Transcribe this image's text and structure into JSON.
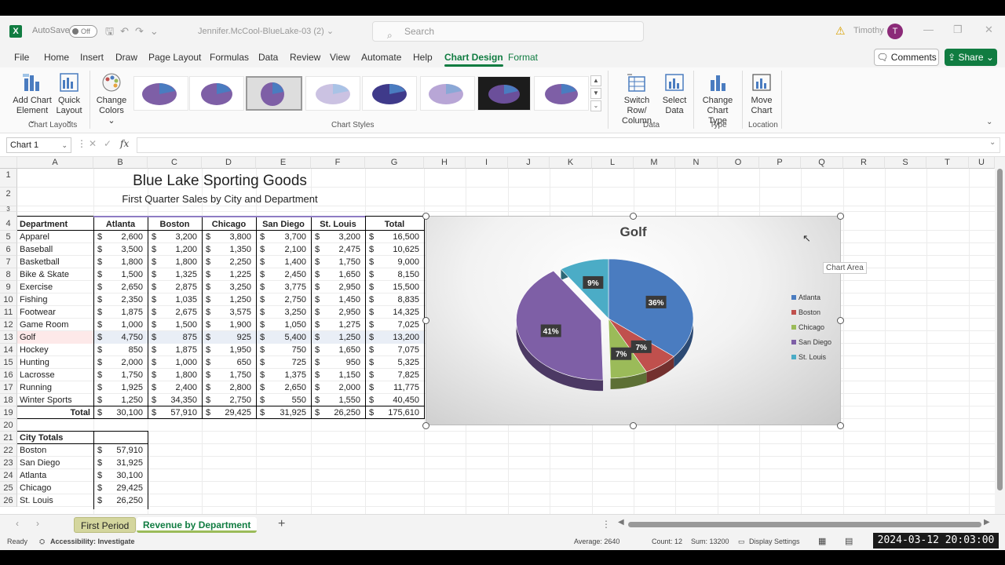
{
  "titlebar": {
    "autosave_label": "AutoSave",
    "toggle_label": "Off",
    "filename": "Jennifer.McCool-BlueLake-03 (2) ⌄",
    "search_placeholder": "Search",
    "username": "Timothy",
    "avatar_initial": "T"
  },
  "ribbon_tabs": [
    "File",
    "Home",
    "Insert",
    "Draw",
    "Page Layout",
    "Formulas",
    "Data",
    "Review",
    "View",
    "Automate",
    "Help",
    "Chart Design",
    "Format"
  ],
  "active_tab": "Chart Design",
  "buttons": {
    "comments": "Comments",
    "share": "Share"
  },
  "ribbon": {
    "add_chart_element": [
      "Add Chart",
      "Element ⌄"
    ],
    "quick_layout": [
      "Quick",
      "Layout ⌄"
    ],
    "change_colors": [
      "Change",
      "Colors ⌄"
    ],
    "switch_row_col": [
      "Switch Row/",
      "Column"
    ],
    "select_data": [
      "Select",
      "Data"
    ],
    "change_chart_type": [
      "Change",
      "Chart Type"
    ],
    "move_chart": [
      "Move",
      "Chart"
    ],
    "group_labels": {
      "chart_layouts": "Chart Layouts",
      "chart_styles": "Chart Styles",
      "data": "Data",
      "type": "Type",
      "location": "Location"
    }
  },
  "formula_bar": {
    "name_box": "Chart 1",
    "fx": "fx"
  },
  "columns": [
    "A",
    "B",
    "C",
    "D",
    "E",
    "F",
    "G",
    "H",
    "I",
    "J",
    "K",
    "L",
    "M",
    "N",
    "O",
    "P",
    "Q",
    "R",
    "S",
    "T",
    "U"
  ],
  "sheet": {
    "title": "Blue Lake Sporting Goods",
    "subtitle": "First Quarter Sales by City and Department",
    "headers": [
      "Department",
      "Atlanta",
      "Boston",
      "Chicago",
      "San Diego",
      "St. Louis",
      "Total"
    ],
    "rows": [
      [
        "Apparel",
        "2,600",
        "3,200",
        "3,800",
        "3,700",
        "3,200",
        "16,500"
      ],
      [
        "Baseball",
        "3,500",
        "1,200",
        "1,350",
        "2,100",
        "2,475",
        "10,625"
      ],
      [
        "Basketball",
        "1,800",
        "1,800",
        "2,250",
        "1,400",
        "1,750",
        "9,000"
      ],
      [
        "Bike & Skate",
        "1,500",
        "1,325",
        "1,225",
        "2,450",
        "1,650",
        "8,150"
      ],
      [
        "Exercise",
        "2,650",
        "2,875",
        "3,250",
        "3,775",
        "2,950",
        "15,500"
      ],
      [
        "Fishing",
        "2,350",
        "1,035",
        "1,250",
        "2,750",
        "1,450",
        "8,835"
      ],
      [
        "Footwear",
        "1,875",
        "2,675",
        "3,575",
        "3,250",
        "2,950",
        "14,325"
      ],
      [
        "Game Room",
        "1,000",
        "1,500",
        "1,900",
        "1,050",
        "1,275",
        "7,025"
      ],
      [
        "Golf",
        "4,750",
        "875",
        "925",
        "5,400",
        "1,250",
        "13,200"
      ],
      [
        "Hockey",
        "850",
        "1,875",
        "1,950",
        "750",
        "1,650",
        "7,075"
      ],
      [
        "Hunting",
        "2,000",
        "1,000",
        "650",
        "725",
        "950",
        "5,325"
      ],
      [
        "Lacrosse",
        "1,750",
        "1,800",
        "1,750",
        "1,375",
        "1,150",
        "7,825"
      ],
      [
        "Running",
        "1,925",
        "2,400",
        "2,800",
        "2,650",
        "2,000",
        "11,775"
      ],
      [
        "Winter Sports",
        "1,250",
        "34,350",
        "2,750",
        "550",
        "1,550",
        "40,450"
      ]
    ],
    "total_row": [
      "Total",
      "30,100",
      "57,910",
      "29,425",
      "31,925",
      "26,250",
      "175,610"
    ],
    "city_totals_header": "City Totals",
    "city_totals": [
      [
        "Boston",
        "57,910"
      ],
      [
        "San Diego",
        "31,925"
      ],
      [
        "Atlanta",
        "30,100"
      ],
      [
        "Chicago",
        "29,425"
      ],
      [
        "St. Louis",
        "26,250"
      ]
    ],
    "currency_symbol": "$"
  },
  "chart_data": {
    "type": "pie",
    "title": "Golf",
    "categories": [
      "Atlanta",
      "Boston",
      "Chicago",
      "San Diego",
      "St. Louis"
    ],
    "values": [
      4750,
      875,
      925,
      5400,
      1250
    ],
    "data_labels": [
      "36%",
      "7%",
      "7%",
      "41%",
      "9%"
    ],
    "colors": [
      "#4a7cc0",
      "#c0504d",
      "#9bbb59",
      "#7e5fa6",
      "#4bacc6"
    ],
    "exploded": [
      "San Diego"
    ],
    "legend_position": "right",
    "chart_area_tooltip": "Chart Area"
  },
  "sheet_tabs": [
    "First Period",
    "Revenue by Department"
  ],
  "active_sheet": "Revenue by Department",
  "status_bar": {
    "ready": "Ready",
    "accessibility": "Accessibility: Investigate",
    "average": "Average: 2640",
    "count": "Count: 12",
    "sum": "Sum: 13200",
    "display_settings": "Display Settings"
  },
  "timestamp": "2024-03-12 20:03:00"
}
